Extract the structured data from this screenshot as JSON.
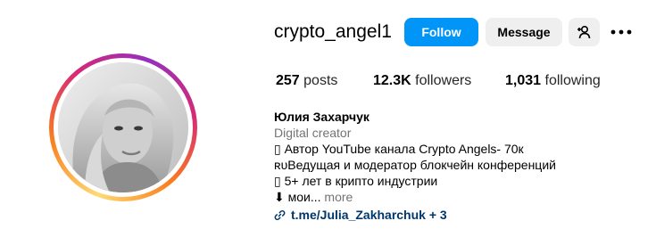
{
  "profile": {
    "username": "crypto_angel1",
    "full_name": "Юлия Захарчук",
    "category": "Digital creator",
    "bio_lines": [
      "▯ Автор YouTube канала Crypto Angels- 70к",
      "ʀᴜВедущая и модератор блокчейн конференций",
      "▯ 5+ лет в крипто индустрии"
    ],
    "bio_truncated": "⬇ мои...",
    "more_label": "more",
    "link_text": "t.me/Julia_Zakharchuk",
    "link_extra": "+ 3"
  },
  "actions": {
    "follow_label": "Follow",
    "message_label": "Message",
    "suggest_icon": "add-person-icon",
    "more_icon": "more-options-icon"
  },
  "stats": {
    "posts": {
      "value": "257",
      "label": "posts"
    },
    "followers": {
      "value": "12.3K",
      "label": "followers"
    },
    "following": {
      "value": "1,031",
      "label": "following"
    }
  },
  "colors": {
    "follow_button": "#0095f6",
    "secondary_button": "#efefef",
    "link": "#00376b",
    "muted_text": "#737373",
    "story_ring": [
      "#feda75",
      "#fa7e1e",
      "#d62976",
      "#962fbf"
    ]
  }
}
